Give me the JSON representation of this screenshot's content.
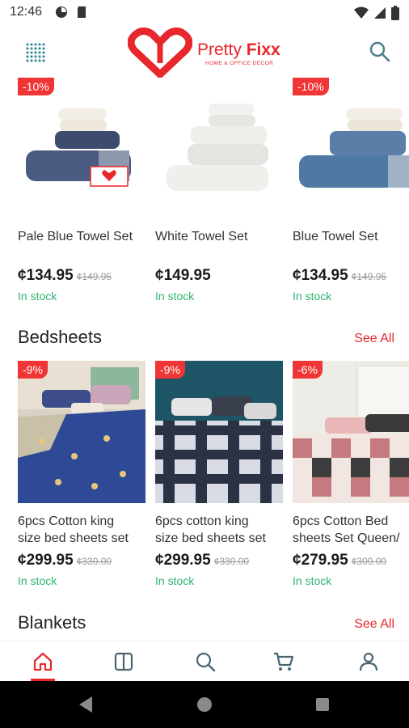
{
  "status_bar": {
    "time": "12:46",
    "left_icons": [
      "data-saver-icon",
      "sd-card-icon"
    ],
    "right_icons": [
      "wifi-icon",
      "signal-icon",
      "battery-icon"
    ]
  },
  "header": {
    "brand_first": "Pretty ",
    "brand_second": "Fixx",
    "tagline": "HOME & OFFICE DECOR",
    "brand_color": "#e8272c"
  },
  "towels": {
    "products": [
      {
        "name": "Pale Blue Towel Set",
        "price": "¢134.95",
        "old_price": "¢149.95",
        "discount": "-10%",
        "stock": "In stock"
      },
      {
        "name": "White Towel Set",
        "price": "¢149.95",
        "old_price": "",
        "discount": "",
        "stock": "In stock"
      },
      {
        "name": "Blue Towel Set",
        "price": "¢134.95",
        "old_price": "¢149.95",
        "discount": "-10%",
        "stock": "In stock"
      }
    ]
  },
  "bedsheets": {
    "title": "Bedsheets",
    "see_all": "See All",
    "products": [
      {
        "name_line1": "6pcs Cotton king",
        "name_line2": "size bed sheets set",
        "price": "¢299.95",
        "old_price": "¢330.00",
        "discount": "-9%",
        "stock": "In stock"
      },
      {
        "name_line1": "6pcs cotton king",
        "name_line2": "size bed sheets set",
        "price": "¢299.95",
        "old_price": "¢330.00",
        "discount": "-9%",
        "stock": "In stock"
      },
      {
        "name_line1": "6pcs Cotton Bed",
        "name_line2": "sheets Set Queen/",
        "price": "¢279.95",
        "old_price": "¢300.00",
        "discount": "-6%",
        "stock": "In stock"
      }
    ]
  },
  "blankets": {
    "title": "Blankets",
    "see_all": "See All"
  },
  "bottom_nav": {
    "items": [
      "home-icon",
      "catalog-icon",
      "search-icon",
      "cart-icon",
      "account-icon"
    ],
    "active": "home-icon"
  },
  "colors": {
    "accent": "#e8272c",
    "stock_green": "#2fb36f",
    "badge_red": "#ef3535"
  }
}
